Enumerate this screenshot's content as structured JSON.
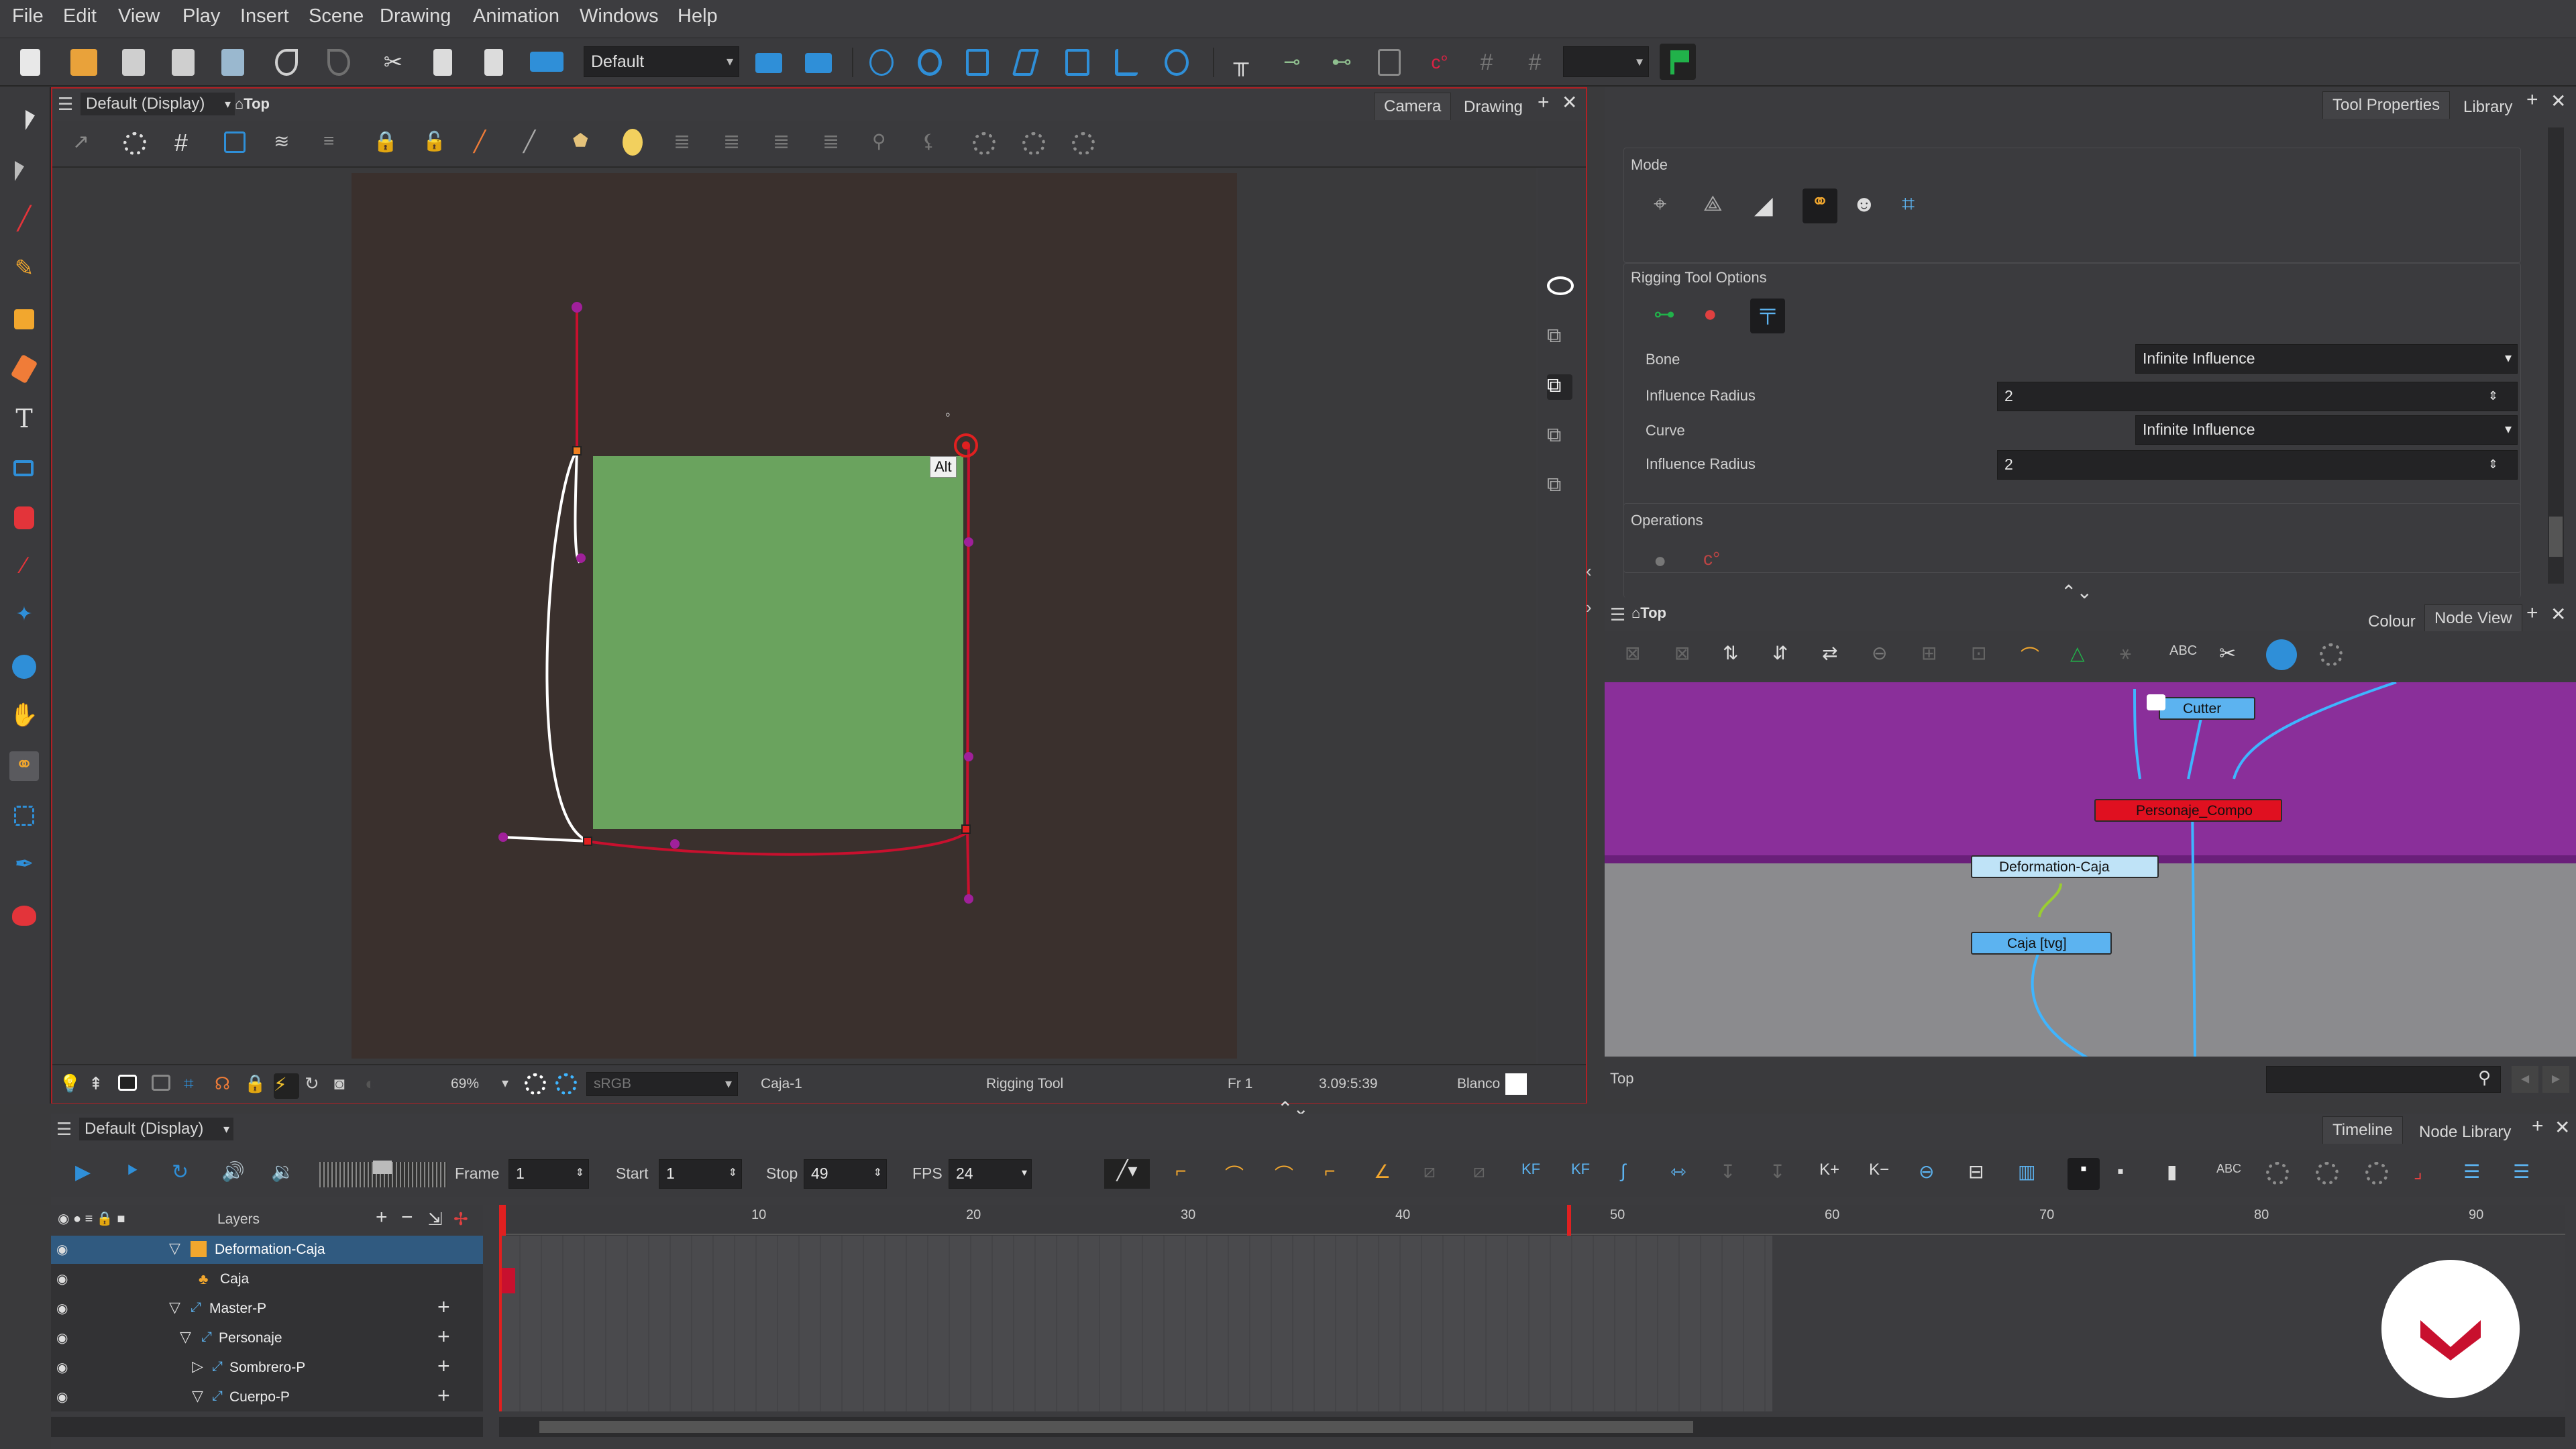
{
  "menu": [
    "File",
    "Edit",
    "View",
    "Play",
    "Insert",
    "Scene",
    "Drawing",
    "Animation",
    "Windows",
    "Help"
  ],
  "toolbar": {
    "workspace_value": "Default",
    "right_dropdown_value": ""
  },
  "left_tools": [
    "select-tool",
    "contour-select-tool",
    "brush-tool",
    "pencil-tool",
    "paint-tool",
    "eraser-tool",
    "text-tool",
    "rectangle-tool",
    "paint-bucket-tool",
    "dropper-tool",
    "pivot-tool",
    "morph-tool",
    "hand-tool",
    "rigging-tool",
    "transform-tool",
    "pen-tool",
    "inverse-kinematics-tool"
  ],
  "camera_view": {
    "view_label": "Default (Display)",
    "scene_label": "Top",
    "tab_camera": "Camera",
    "tab_drawing": "Drawing",
    "alt_tooltip": "Alt",
    "status": {
      "zoom": "69%",
      "colorspace": "sRGB",
      "drawing": "Caja-1",
      "tool": "Rigging Tool",
      "frame": "Fr 1",
      "coords": "3.09:5:39",
      "bg_label": "Blanco"
    }
  },
  "tool_properties": {
    "tab_active": "Tool Properties",
    "tab_library": "Library",
    "mode_label": "Mode",
    "rigging_options_label": "Rigging Tool Options",
    "bone_label": "Bone",
    "bone_value": "Infinite Influence",
    "bone_radius_label": "Influence Radius",
    "bone_radius_value": "2",
    "curve_label": "Curve",
    "curve_value": "Infinite Influence",
    "curve_radius_label": "Influence Radius",
    "curve_radius_value": "2",
    "operations_label": "Operations"
  },
  "node_view": {
    "scene_label": "Top",
    "tab_colour": "Colour",
    "tab_node_view": "Node View",
    "nodes": {
      "cutter": "Cutter",
      "personaje_compo": "Personaje_Compo",
      "deformation_caja": "Deformation-Caja",
      "caja_tvg": "Caja [tvg]"
    },
    "footer_path": "Top"
  },
  "timeline": {
    "view_label": "Default (Display)",
    "tab_timeline": "Timeline",
    "tab_node_library": "Node Library",
    "frame_label": "Frame",
    "frame_value": "1",
    "start_label": "Start",
    "start_value": "1",
    "stop_label": "Stop",
    "stop_value": "49",
    "fps_label": "FPS",
    "fps_value": "24",
    "layers_header": "Layers",
    "layers": [
      {
        "name": "Deformation-Caja",
        "indent": 0
      },
      {
        "name": "Caja",
        "indent": 1
      },
      {
        "name": "Master-P",
        "indent": 0
      },
      {
        "name": "Personaje",
        "indent": 1
      },
      {
        "name": "Sombrero-P",
        "indent": 2
      },
      {
        "name": "Cuerpo-P",
        "indent": 2
      }
    ],
    "ruler": [
      "10",
      "20",
      "30",
      "40",
      "50",
      "60",
      "70",
      "80",
      "90"
    ]
  },
  "colors": {
    "accent_blue": "#2f8fd8",
    "canvas_bg": "#3a302d",
    "shape_green": "#6aa35e",
    "node_area": "#8a2f9a",
    "deform_red": "#c8102e"
  }
}
